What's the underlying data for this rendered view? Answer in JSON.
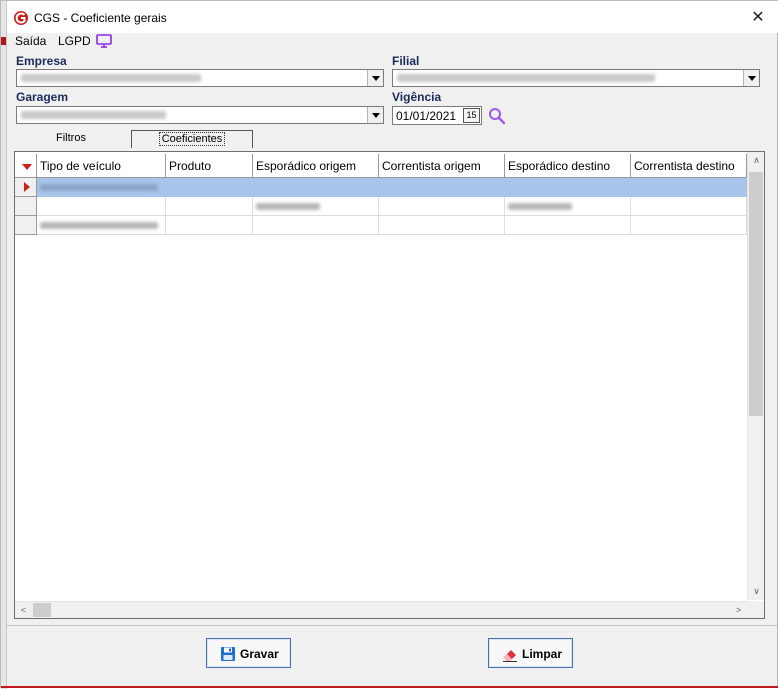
{
  "window": {
    "title": "CGS - Coeficiente gerais",
    "close_glyph": "✕"
  },
  "menu": {
    "items": [
      "Saída",
      "LGPD"
    ]
  },
  "fields": {
    "empresa_label": "Empresa",
    "filial_label": "Filial",
    "garagem_label": "Garagem",
    "vigencia_label": "Vigência",
    "vigencia_value": "01/01/2021",
    "calendar_glyph": "15"
  },
  "tabs": [
    {
      "label": "Filtros",
      "active": false
    },
    {
      "label": "Coeficientes",
      "active": true
    }
  ],
  "grid": {
    "columns": [
      "Tipo de veículo",
      "Produto",
      "Esporádico origem",
      "Correntista origem",
      "Esporádico destino",
      "Correntista destino"
    ]
  },
  "scroll": {
    "up": "∧",
    "down": "∨",
    "left": "<",
    "right": ">"
  },
  "buttons": {
    "save_label": "Gravar",
    "clear_label": "Limpar"
  },
  "icons": {
    "app": "cgs-logo-icon",
    "tv": "tv-icon",
    "search": "search-icon",
    "save": "floppy-disk-icon",
    "clear": "eraser-icon"
  },
  "colors": {
    "accent": "#a9c4ea",
    "label": "#1c2a5a",
    "indicator": "#d02020",
    "lgpd_icon": "#8a2be2"
  }
}
